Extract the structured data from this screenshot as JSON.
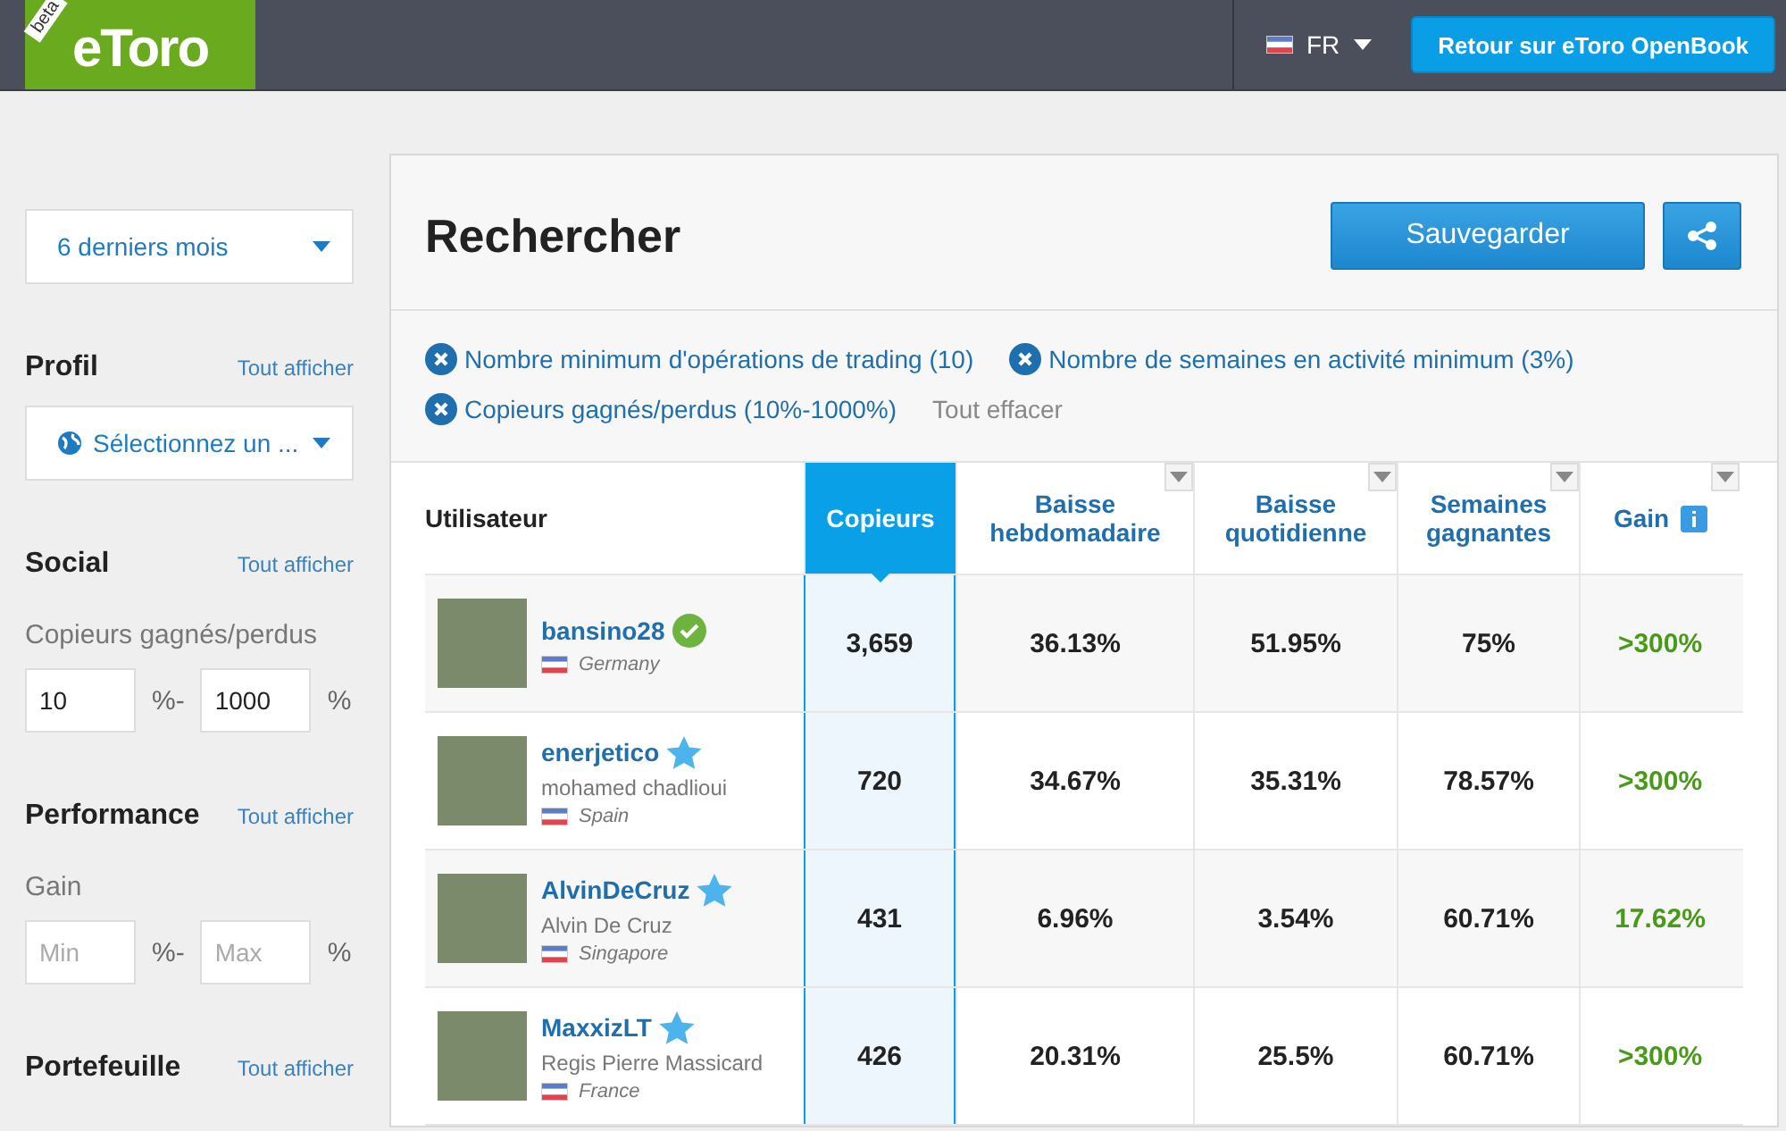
{
  "header": {
    "logo": {
      "badge": "beta",
      "wordmark": "eToro"
    },
    "language": "FR",
    "back_button": "Retour sur eToro OpenBook"
  },
  "sidebar": {
    "period": "6 derniers mois",
    "sections": [
      {
        "kind": "select",
        "title": "Profil",
        "link": "Tout afficher",
        "select": "Sélectionnez un ..."
      },
      {
        "kind": "range",
        "title": "Social",
        "link": "Tout afficher",
        "label": "Copieurs gagnés/perdus",
        "min": {
          "value": "10"
        },
        "sep": "%-",
        "max": {
          "value": "1000"
        },
        "unit": "%"
      },
      {
        "kind": "range",
        "title": "Performance",
        "link": "Tout afficher",
        "label": "Gain",
        "min": {
          "placeholder": "Min"
        },
        "sep": "%-",
        "max": {
          "placeholder": "Max"
        },
        "unit": "%"
      },
      {
        "kind": "title",
        "title": "Portefeuille",
        "link": "Tout afficher"
      }
    ]
  },
  "main": {
    "title": "Rechercher",
    "save_button": "Sauvegarder",
    "filters": [
      "Nombre minimum d'opérations de trading (10)",
      "Nombre de semaines en activité minimum (3%)",
      "Copieurs gagnés/perdus (10%-1000%)"
    ],
    "clear_all": "Tout effacer",
    "table": {
      "columns": [
        {
          "kind": "user",
          "label": "Utilisateur",
          "selected": false
        },
        {
          "kind": "metric",
          "label": "Copieurs",
          "selected": true
        },
        {
          "kind": "metric",
          "label": "Baisse hebdomadaire",
          "selected": false
        },
        {
          "kind": "metric",
          "label": "Baisse quotidienne",
          "selected": false
        },
        {
          "kind": "metric",
          "label": "Semaines gagnantes",
          "selected": false
        },
        {
          "kind": "info",
          "label": "Gain",
          "selected": false
        }
      ],
      "rows": [
        {
          "kind": "verified",
          "cells": [
            {
              "username": "bansino28",
              "country": "Germany"
            },
            "3,659",
            "36.13%",
            "51.95%",
            "75%",
            ">300%"
          ]
        },
        {
          "kind": "star",
          "cells": [
            {
              "username": "enerjetico",
              "real_name": "mohamed chadlioui",
              "country": "Spain"
            },
            "720",
            "34.67%",
            "35.31%",
            "78.57%",
            ">300%"
          ]
        },
        {
          "kind": "star",
          "cells": [
            {
              "username": "AlvinDeCruz",
              "real_name": "Alvin De Cruz",
              "country": "Singapore"
            },
            "431",
            "6.96%",
            "3.54%",
            "60.71%",
            "17.62%"
          ]
        },
        {
          "kind": "star",
          "cells": [
            {
              "username": "MaxxizLT",
              "real_name": "Regis Pierre Massicard",
              "country": "France"
            },
            "426",
            "20.31%",
            "25.5%",
            "60.71%",
            ">300%"
          ]
        }
      ]
    }
  }
}
